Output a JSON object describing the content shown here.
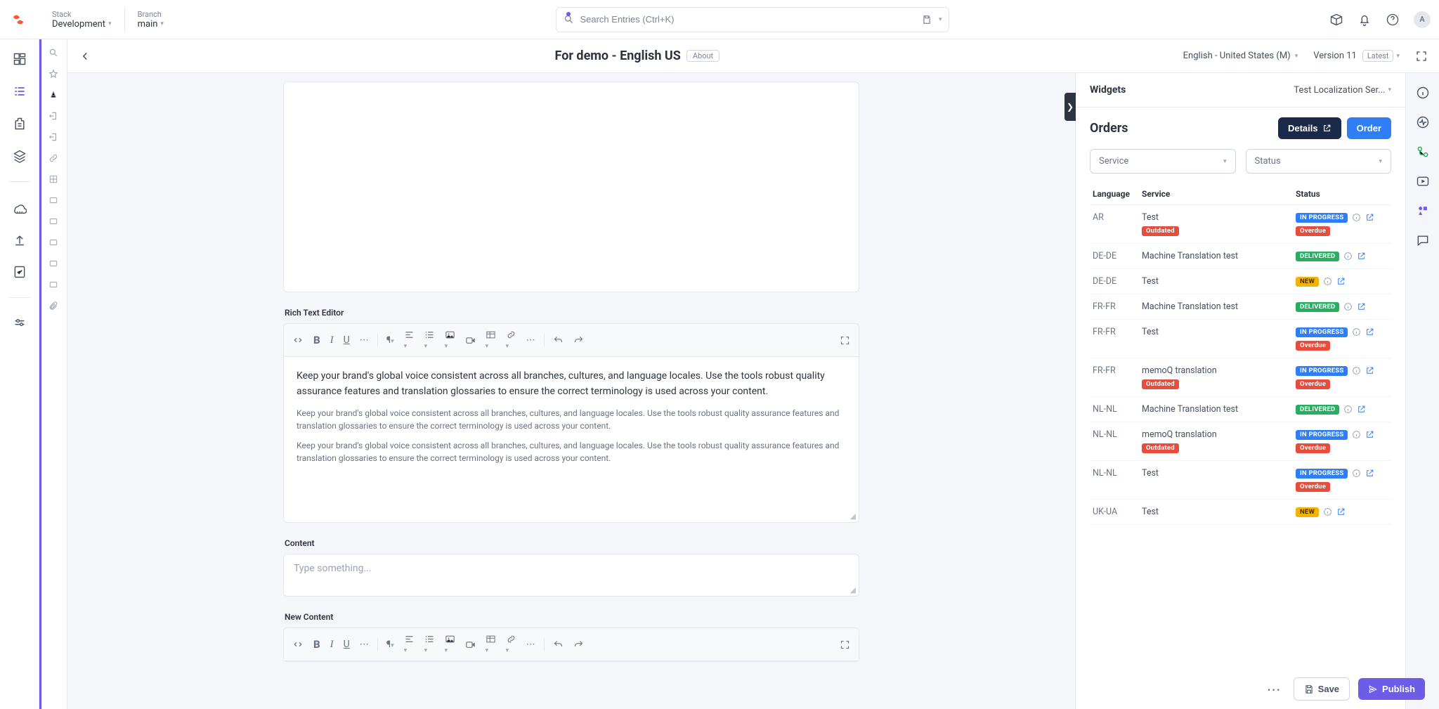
{
  "topbar": {
    "stack_label": "Stack",
    "stack_value": "Development",
    "branch_label": "Branch",
    "branch_value": "main",
    "search_placeholder": "Search Entries (Ctrl+K)",
    "avatar_initial": "A"
  },
  "header": {
    "title": "For demo - English US",
    "about": "About",
    "locale": "English - United States (M)",
    "version_label": "Version 11",
    "version_chip": "Latest"
  },
  "editor": {
    "rte_label": "Rich Text Editor",
    "para1": "Keep your brand's global voice consistent across all branches, cultures, and language locales. Use the tools robust quality assurance features and translation glossaries to ensure the correct terminology is used across your content.",
    "para2": "Keep your brand's global voice consistent across all branches, cultures, and language locales. Use the tools robust quality assurance features and translation glossaries to ensure the correct terminology is used across your content.",
    "para3": "Keep your brand's global voice consistent across all branches, cultures, and language locales. Use the tools robust quality assurance features and translation glossaries to ensure the correct terminology is used across your content.",
    "content_label": "Content",
    "content_placeholder": "Type something...",
    "new_content_label": "New Content"
  },
  "widgets": {
    "panel_title": "Widgets",
    "selector": "Test Localization Ser...",
    "orders_title": "Orders",
    "details_btn": "Details",
    "order_btn": "Order",
    "filter_service": "Service",
    "filter_status": "Status",
    "col_lang": "Language",
    "col_service": "Service",
    "col_status": "Status",
    "rows": [
      {
        "lang": "AR",
        "service": "Test",
        "service_badge": "Outdated",
        "status": "IN PROGRESS",
        "status_sub": "Overdue"
      },
      {
        "lang": "DE-DE",
        "service": "Machine Translation test",
        "service_badge": "",
        "status": "DELIVERED",
        "status_sub": ""
      },
      {
        "lang": "DE-DE",
        "service": "Test",
        "service_badge": "",
        "status": "NEW",
        "status_sub": ""
      },
      {
        "lang": "FR-FR",
        "service": "Machine Translation test",
        "service_badge": "",
        "status": "DELIVERED",
        "status_sub": ""
      },
      {
        "lang": "FR-FR",
        "service": "Test",
        "service_badge": "",
        "status": "IN PROGRESS",
        "status_sub": "Overdue"
      },
      {
        "lang": "FR-FR",
        "service": "memoQ translation",
        "service_badge": "Outdated",
        "status": "IN PROGRESS",
        "status_sub": "Overdue"
      },
      {
        "lang": "NL-NL",
        "service": "Machine Translation test",
        "service_badge": "",
        "status": "DELIVERED",
        "status_sub": ""
      },
      {
        "lang": "NL-NL",
        "service": "memoQ translation",
        "service_badge": "Outdated",
        "status": "IN PROGRESS",
        "status_sub": "Overdue"
      },
      {
        "lang": "NL-NL",
        "service": "Test",
        "service_badge": "",
        "status": "IN PROGRESS",
        "status_sub": "Overdue"
      },
      {
        "lang": "UK-UA",
        "service": "Test",
        "service_badge": "",
        "status": "NEW",
        "status_sub": ""
      }
    ]
  },
  "footer": {
    "save": "Save",
    "publish": "Publish"
  }
}
